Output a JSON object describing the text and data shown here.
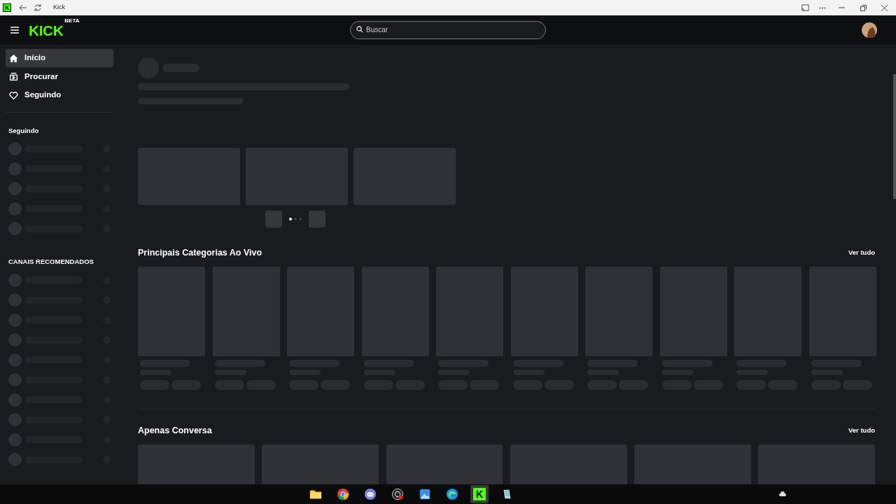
{
  "window": {
    "app_icon_letter": "K",
    "title": "Kick"
  },
  "header": {
    "logo": "KICK",
    "logo_badge": "BETA",
    "search": {
      "placeholder": "Buscar"
    }
  },
  "sidebar": {
    "nav": [
      {
        "label": "Início",
        "kind": "home",
        "selected": true
      },
      {
        "label": "Procurar",
        "kind": "browse",
        "selected": false
      },
      {
        "label": "Seguindo",
        "kind": "heart",
        "selected": false
      }
    ],
    "sections": [
      {
        "title": "Seguindo"
      },
      {
        "title": "CANAIS RECOMENDADOS"
      }
    ]
  },
  "carousel": {
    "dots": [
      {
        "selected": true
      },
      {
        "selected": false
      },
      {
        "selected": false
      }
    ]
  },
  "sections": [
    {
      "title": "Principais Categorias Ao Vivo",
      "link": "Ver tudo",
      "kind": "categories"
    },
    {
      "title": "Apenas Conversa",
      "link": "Ver tudo",
      "kind": "streams"
    }
  ],
  "taskbar": {
    "apps": [
      {
        "kind": "folder",
        "selected": false
      },
      {
        "kind": "chrome",
        "selected": false
      },
      {
        "kind": "discord",
        "selected": false
      },
      {
        "kind": "obs",
        "selected": false
      },
      {
        "kind": "photos",
        "selected": false
      },
      {
        "kind": "edge",
        "selected": false
      },
      {
        "kind": "kick",
        "letter": "K",
        "selected": true
      },
      {
        "kind": "notes",
        "selected": false
      }
    ]
  }
}
